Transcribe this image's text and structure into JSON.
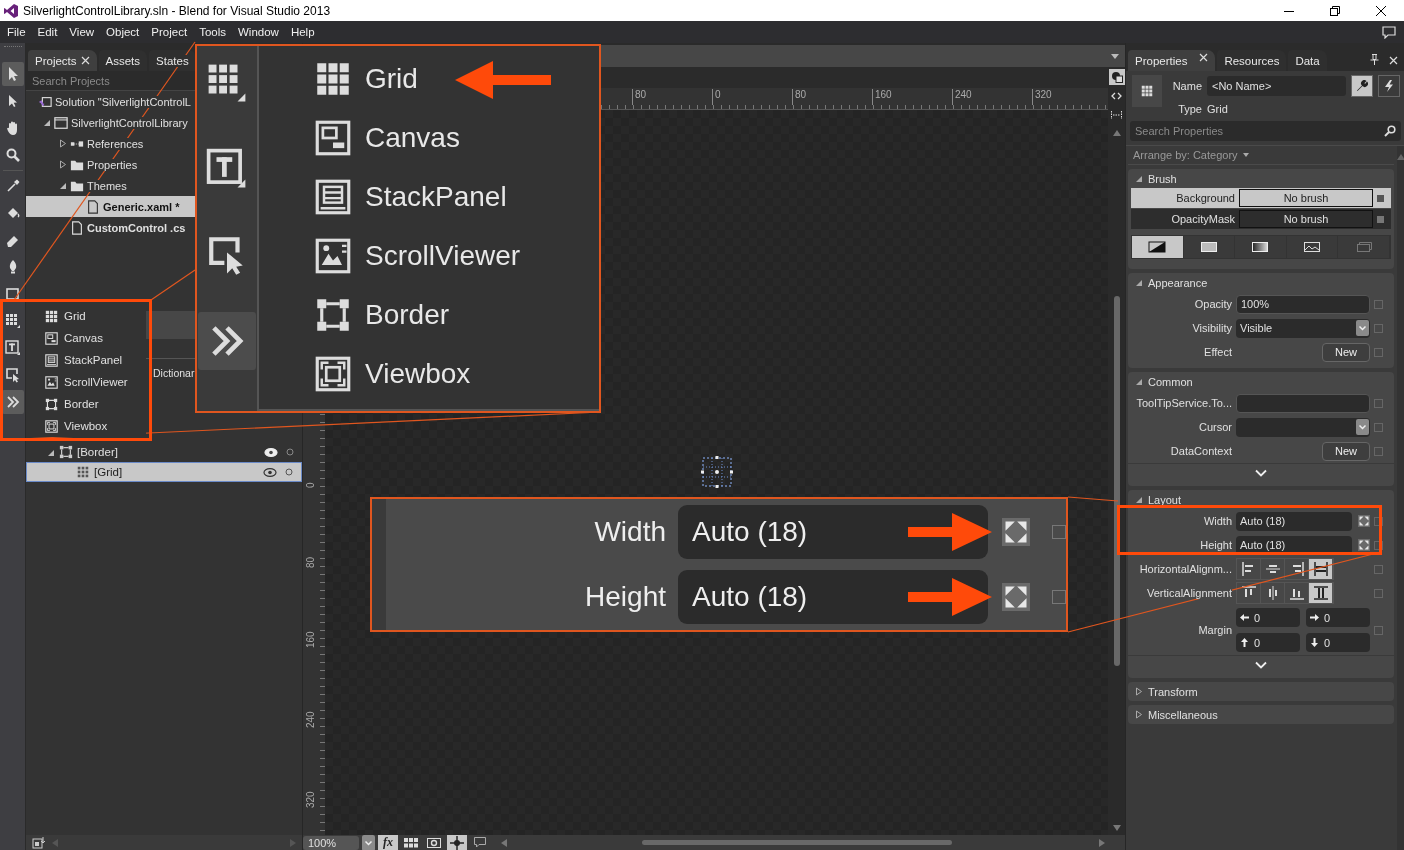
{
  "window": {
    "title": "SilverlightControlLibrary.sln - Blend for Visual Studio 2013"
  },
  "menu": [
    "File",
    "Edit",
    "View",
    "Object",
    "Project",
    "Tools",
    "Window",
    "Help"
  ],
  "tools": [
    {
      "kind": "select",
      "selected": true
    },
    {
      "kind": "direct-select",
      "selected": false
    },
    {
      "kind": "pan",
      "selected": false
    },
    {
      "kind": "zoom",
      "selected": false
    },
    {
      "kind": "eyedropper",
      "selected": false
    },
    {
      "kind": "paint-bucket",
      "selected": false
    },
    {
      "kind": "eraser",
      "selected": false
    },
    {
      "kind": "pen",
      "selected": false
    },
    {
      "kind": "rectangle",
      "selected": false
    },
    {
      "kind": "grid",
      "selected": false
    },
    {
      "kind": "textblock",
      "selected": false
    },
    {
      "kind": "control",
      "selected": false
    },
    {
      "kind": "more",
      "selected": true
    }
  ],
  "left_panel": {
    "tabs": [
      {
        "label": "Projects",
        "selected": true,
        "closable": true
      },
      {
        "label": "Assets",
        "selected": false,
        "closable": false
      },
      {
        "label": "States",
        "selected": false,
        "closable": false
      }
    ],
    "search": {
      "placeholder": "Search Projects"
    },
    "tree": [
      {
        "label": "Solution \"SilverlightControlL",
        "kind": "solution",
        "selected": false,
        "children": [
          {
            "label": "SilverlightControlLibrary",
            "kind": "project",
            "selected": false,
            "expanded": true,
            "children": [
              {
                "label": "References",
                "kind": "references",
                "selected": false,
                "expanded": false
              },
              {
                "label": "Properties",
                "kind": "folder",
                "selected": false,
                "expanded": false
              },
              {
                "label": "Themes",
                "kind": "folder",
                "selected": false,
                "expanded": true,
                "children": [
                  {
                    "label": "Generic.xaml *",
                    "kind": "file",
                    "selected": true,
                    "modified": true
                  }
                ]
              },
              {
                "label": "CustomControl .cs",
                "kind": "file",
                "selected": false,
                "modified": true
              }
            ]
          }
        ]
      }
    ],
    "fragment": "Dictionar",
    "objects": [
      {
        "label": "[Border]",
        "kind": "border",
        "selected": false,
        "expanded": true,
        "children": [
          {
            "label": "[Grid]",
            "kind": "grid",
            "selected": true
          }
        ]
      }
    ]
  },
  "flyout": {
    "items": [
      {
        "kind": "grid",
        "label": "Grid"
      },
      {
        "kind": "canvas",
        "label": "Canvas"
      },
      {
        "kind": "stackpanel",
        "label": "StackPanel"
      },
      {
        "kind": "scrollviewer",
        "label": "ScrollViewer"
      },
      {
        "kind": "border",
        "label": "Border"
      },
      {
        "kind": "viewbox",
        "label": "Viewbox"
      }
    ]
  },
  "zoom_callout": {
    "tools": [
      {
        "kind": "grid",
        "selected": false
      },
      {
        "kind": "textblock",
        "selected": false
      },
      {
        "kind": "control",
        "selected": false
      },
      {
        "kind": "more",
        "selected": true
      }
    ],
    "items": [
      {
        "kind": "grid",
        "label": "Grid",
        "pointer": true
      },
      {
        "kind": "canvas",
        "label": "Canvas",
        "pointer": false
      },
      {
        "kind": "stackpanel",
        "label": "StackPanel",
        "pointer": false
      },
      {
        "kind": "scrollviewer",
        "label": "ScrollViewer",
        "pointer": false
      },
      {
        "kind": "border",
        "label": "Border",
        "pointer": false
      },
      {
        "kind": "viewbox",
        "label": "Viewbox",
        "pointer": false
      }
    ]
  },
  "document": {
    "rulers": {
      "horizontal": [
        "80",
        "0",
        "80",
        "160",
        "240",
        "320"
      ],
      "vertical": [
        "0",
        "80",
        "160",
        "240",
        "320"
      ]
    }
  },
  "status": {
    "zoom": "100%",
    "toggles": [
      {
        "kind": "fx",
        "label": "fx",
        "on": true
      },
      {
        "kind": "grid",
        "on": false
      },
      {
        "kind": "snap",
        "on": false
      },
      {
        "kind": "snaplines",
        "on": true
      },
      {
        "kind": "annotation",
        "on": false
      }
    ]
  },
  "properties": {
    "tabs": [
      {
        "label": "Properties",
        "selected": true,
        "closable": true
      },
      {
        "label": "Resources",
        "selected": false,
        "closable": false
      },
      {
        "label": "Data",
        "selected": false,
        "closable": false
      }
    ],
    "name_label": "Name",
    "name_value": "<No Name>",
    "type_label": "Type",
    "type_value": "Grid",
    "modes": [
      {
        "kind": "properties",
        "selected": true
      },
      {
        "kind": "events",
        "selected": false
      }
    ],
    "search": {
      "placeholder": "Search Properties"
    },
    "arrange": "Arrange by: Category",
    "sections": [
      {
        "title": "Brush",
        "kind": "brush",
        "expanded": true,
        "rows": [
          {
            "label": "Background",
            "value": "No brush",
            "selected": true
          },
          {
            "label": "OpacityMask",
            "value": "No brush",
            "selected": false
          }
        ],
        "brush_types": [
          {
            "kind": "none",
            "selected": true
          },
          {
            "kind": "solid",
            "selected": false
          },
          {
            "kind": "gradient",
            "selected": false
          },
          {
            "kind": "image",
            "selected": false
          },
          {
            "kind": "resource",
            "selected": false
          }
        ]
      },
      {
        "title": "Appearance",
        "kind": "list",
        "expanded": true,
        "more": false,
        "rows": [
          {
            "kind": "field",
            "label": "Opacity",
            "value": "100%"
          },
          {
            "kind": "dropdown",
            "label": "Visibility",
            "value": "Visible"
          },
          {
            "kind": "button",
            "label": "Effect",
            "value": "New"
          }
        ]
      },
      {
        "title": "Common",
        "kind": "list",
        "expanded": true,
        "more": true,
        "rows": [
          {
            "kind": "field",
            "label": "ToolTipService.To..."
          },
          {
            "kind": "dropdown",
            "label": "Cursor"
          },
          {
            "kind": "button",
            "label": "DataContext",
            "value": "New"
          }
        ]
      },
      {
        "title": "Layout",
        "kind": "list",
        "expanded": true,
        "more": true,
        "rows": [
          {
            "kind": "size",
            "label": "Width",
            "value": "Auto (18)"
          },
          {
            "kind": "size",
            "label": "Height",
            "value": "Auto (18)"
          },
          {
            "kind": "align",
            "label": "HorizontalAlignm...",
            "options": [
              {
                "kind": "left",
                "selected": false
              },
              {
                "kind": "center",
                "selected": false
              },
              {
                "kind": "right",
                "selected": false
              },
              {
                "kind": "stretch",
                "selected": true
              }
            ]
          },
          {
            "kind": "valign",
            "label": "VerticalAlignment",
            "options": [
              {
                "kind": "top",
                "selected": false
              },
              {
                "kind": "center",
                "selected": false
              },
              {
                "kind": "bottom",
                "selected": false
              },
              {
                "kind": "stretch",
                "selected": true
              }
            ]
          },
          {
            "kind": "margin",
            "label": "Margin",
            "values": [
              {
                "kind": "left",
                "value": "0"
              },
              {
                "kind": "right",
                "value": "0"
              },
              {
                "kind": "top",
                "value": "0"
              },
              {
                "kind": "bottom",
                "value": "0"
              }
            ]
          }
        ]
      },
      {
        "title": "Transform",
        "expanded": false
      },
      {
        "title": "Miscellaneous",
        "expanded": false
      }
    ]
  },
  "layout_callout": {
    "rows": [
      {
        "label": "Width",
        "value": "Auto (18)",
        "pointer": true
      },
      {
        "label": "Height",
        "value": "Auto (18)",
        "pointer": true
      }
    ]
  }
}
